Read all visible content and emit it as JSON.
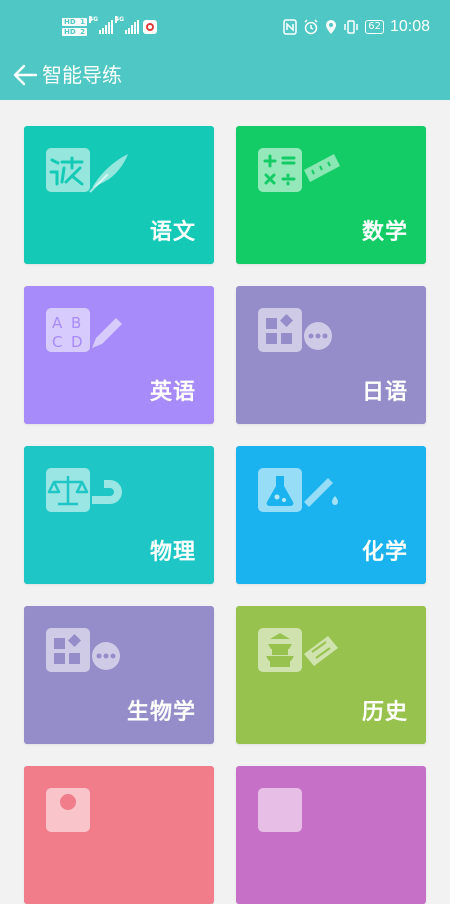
{
  "status_bar": {
    "left": {
      "sim1": "HD",
      "sim1_num": "1",
      "sim2": "HD",
      "sim2_num": "2",
      "network1": "4G",
      "network2": "4G"
    },
    "battery": "62",
    "time": "10:08"
  },
  "app_bar": {
    "title": "智能导练",
    "back_icon": "arrow-left-icon"
  },
  "subjects": [
    {
      "label": "语文",
      "color": "#14c9b6",
      "icon": "chinese-writing-icon"
    },
    {
      "label": "数学",
      "color": "#14cc66",
      "icon": "math-ruler-icon"
    },
    {
      "label": "英语",
      "color": "#a78bfa",
      "icon": "abcd-pencil-icon"
    },
    {
      "label": "日语",
      "color": "#958dca",
      "icon": "shapes-dots-icon"
    },
    {
      "label": "物理",
      "color": "#1ec7c5",
      "icon": "scale-magnet-icon"
    },
    {
      "label": "化学",
      "color": "#1ab3f0",
      "icon": "flask-tube-icon"
    },
    {
      "label": "生物学",
      "color": "#958dca",
      "icon": "shapes-dots-icon"
    },
    {
      "label": "历史",
      "color": "#97c24e",
      "icon": "pagoda-scroll-icon"
    },
    {
      "label": "",
      "color": "#f27d8a",
      "icon": "partial-icon"
    },
    {
      "label": "",
      "color": "#c770c7",
      "icon": "partial-icon"
    }
  ]
}
